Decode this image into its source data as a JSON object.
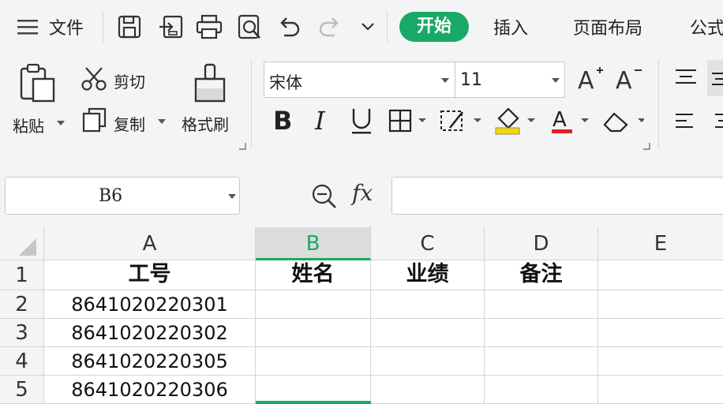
{
  "menu": {
    "file_label": "文件"
  },
  "tabs": [
    {
      "label": "开始",
      "active": true
    },
    {
      "label": "插入"
    },
    {
      "label": "页面布局"
    },
    {
      "label": "公式"
    }
  ],
  "ribbon": {
    "paste_label": "粘贴",
    "cut_label": "剪切",
    "copy_label": "复制",
    "format_painter_label": "格式刷",
    "font_name": "宋体",
    "font_size": "11"
  },
  "formula_bar": {
    "name_box": "B6",
    "fx": "fx",
    "formula": ""
  },
  "sheet": {
    "columns": [
      "A",
      "B",
      "C",
      "D",
      "E"
    ],
    "selected_column": "B",
    "rows": [
      {
        "num": "1",
        "cells": [
          "工号",
          "姓名",
          "业绩",
          "备注",
          ""
        ]
      },
      {
        "num": "2",
        "cells": [
          "8641020220301",
          "",
          "",
          "",
          ""
        ]
      },
      {
        "num": "3",
        "cells": [
          "8641020220302",
          "",
          "",
          "",
          ""
        ]
      },
      {
        "num": "4",
        "cells": [
          "8641020220305",
          "",
          "",
          "",
          ""
        ]
      },
      {
        "num": "5",
        "cells": [
          "8641020220306",
          "",
          "",
          "",
          ""
        ]
      }
    ]
  },
  "colors": {
    "accent": "#1aa866",
    "highlight": "#f5d800",
    "font_color": "#e02020"
  }
}
